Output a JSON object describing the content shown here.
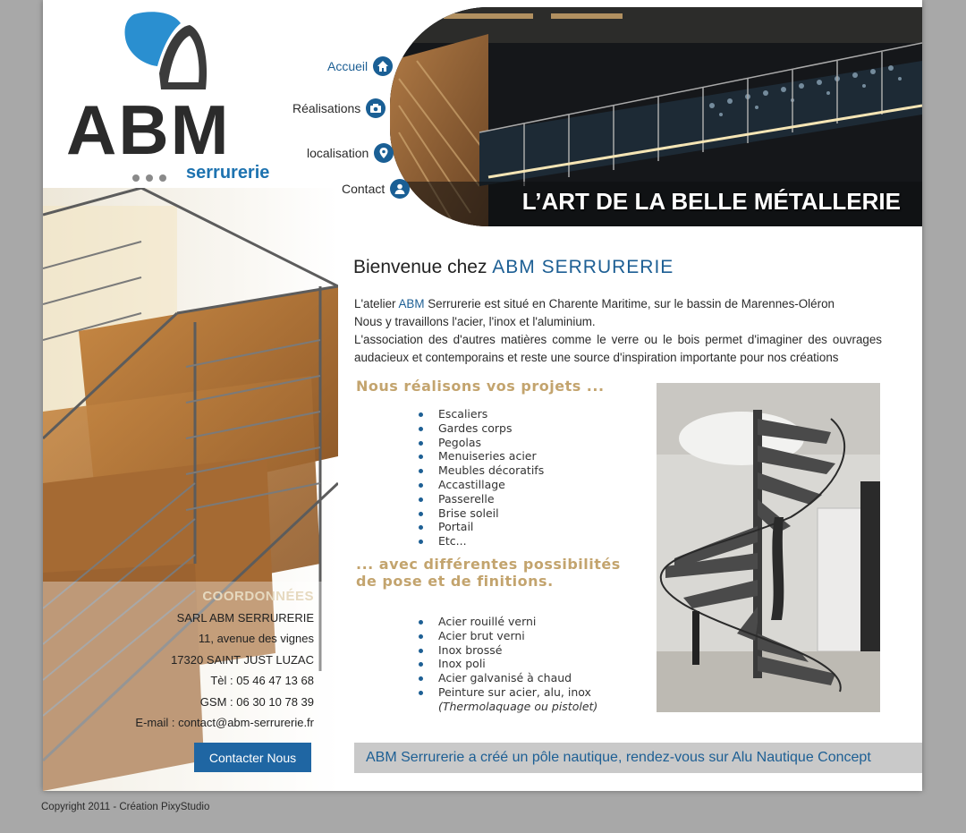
{
  "logo": {
    "text": "ABM",
    "sub": "serrurerie"
  },
  "nav": {
    "items": [
      {
        "label": "Accueil",
        "icon": "home-icon"
      },
      {
        "label": "Réalisations",
        "icon": "camera-icon"
      },
      {
        "label": "localisation",
        "icon": "location-pin-icon"
      },
      {
        "label": "Contact",
        "icon": "user-icon"
      }
    ]
  },
  "banner": {
    "title": "L’ART DE LA BELLE MÉTALLERIE"
  },
  "coords": {
    "title": "COORDONNÉES",
    "company": "SARL ABM SERRURERIE",
    "street": "11, avenue des vignes",
    "city": "17320 SAINT JUST LUZAC",
    "tel": "Tèl : 05 46 47 13 68",
    "gsm": "GSM : 06 30 10 78 39",
    "email": "E-mail : contact@abm-serrurerie.fr"
  },
  "contact_button": "Contacter Nous",
  "welcome": {
    "prefix": "Bienvenue chez ",
    "brand": "ABM SERRURERIE"
  },
  "intro": {
    "p1_a": "L'atelier ",
    "p1_abm": "ABM",
    "p1_b": " Serrurerie est situé en Charente Maritime, sur le bassin de Marennes-Oléron",
    "p2": "Nous y travaillons l'acier, l'inox et l'aluminium.",
    "p3": "L'association des d'autres matières comme le verre ou le bois permet d'imaginer des ouvrages audacieux et contemporains et reste une source d'inspiration importante pour nos créations"
  },
  "projects": {
    "heading": "Nous réalisons vos projets ...",
    "items": [
      "Escaliers",
      "Gardes corps",
      "Pegolas",
      "Menuiseries acier",
      "Meubles décoratifs",
      "Accastillage",
      "Passerelle",
      "Brise soleil",
      "Portail",
      "Etc..."
    ]
  },
  "finishes": {
    "heading": "... avec différentes possibilités de pose et de finitions.",
    "items": [
      "Acier rouillé verni",
      "Acier brut verni",
      "Inox brossé",
      "Inox poli",
      "Acier galvanisé à chaud",
      "Peinture sur acier, alu, inox"
    ],
    "note": "(Thermolaquage ou pistolet)"
  },
  "footer_bar": "ABM Serrurerie a créé un pôle nautique, rendez-vous sur Alu Nautique Concept",
  "copyright": "Copyright 2011 - Création PixyStudio",
  "colors": {
    "accent": "#1d5f94",
    "gold": "#c3a46e",
    "button": "#1f66a3",
    "background": "#a8a8a8"
  }
}
